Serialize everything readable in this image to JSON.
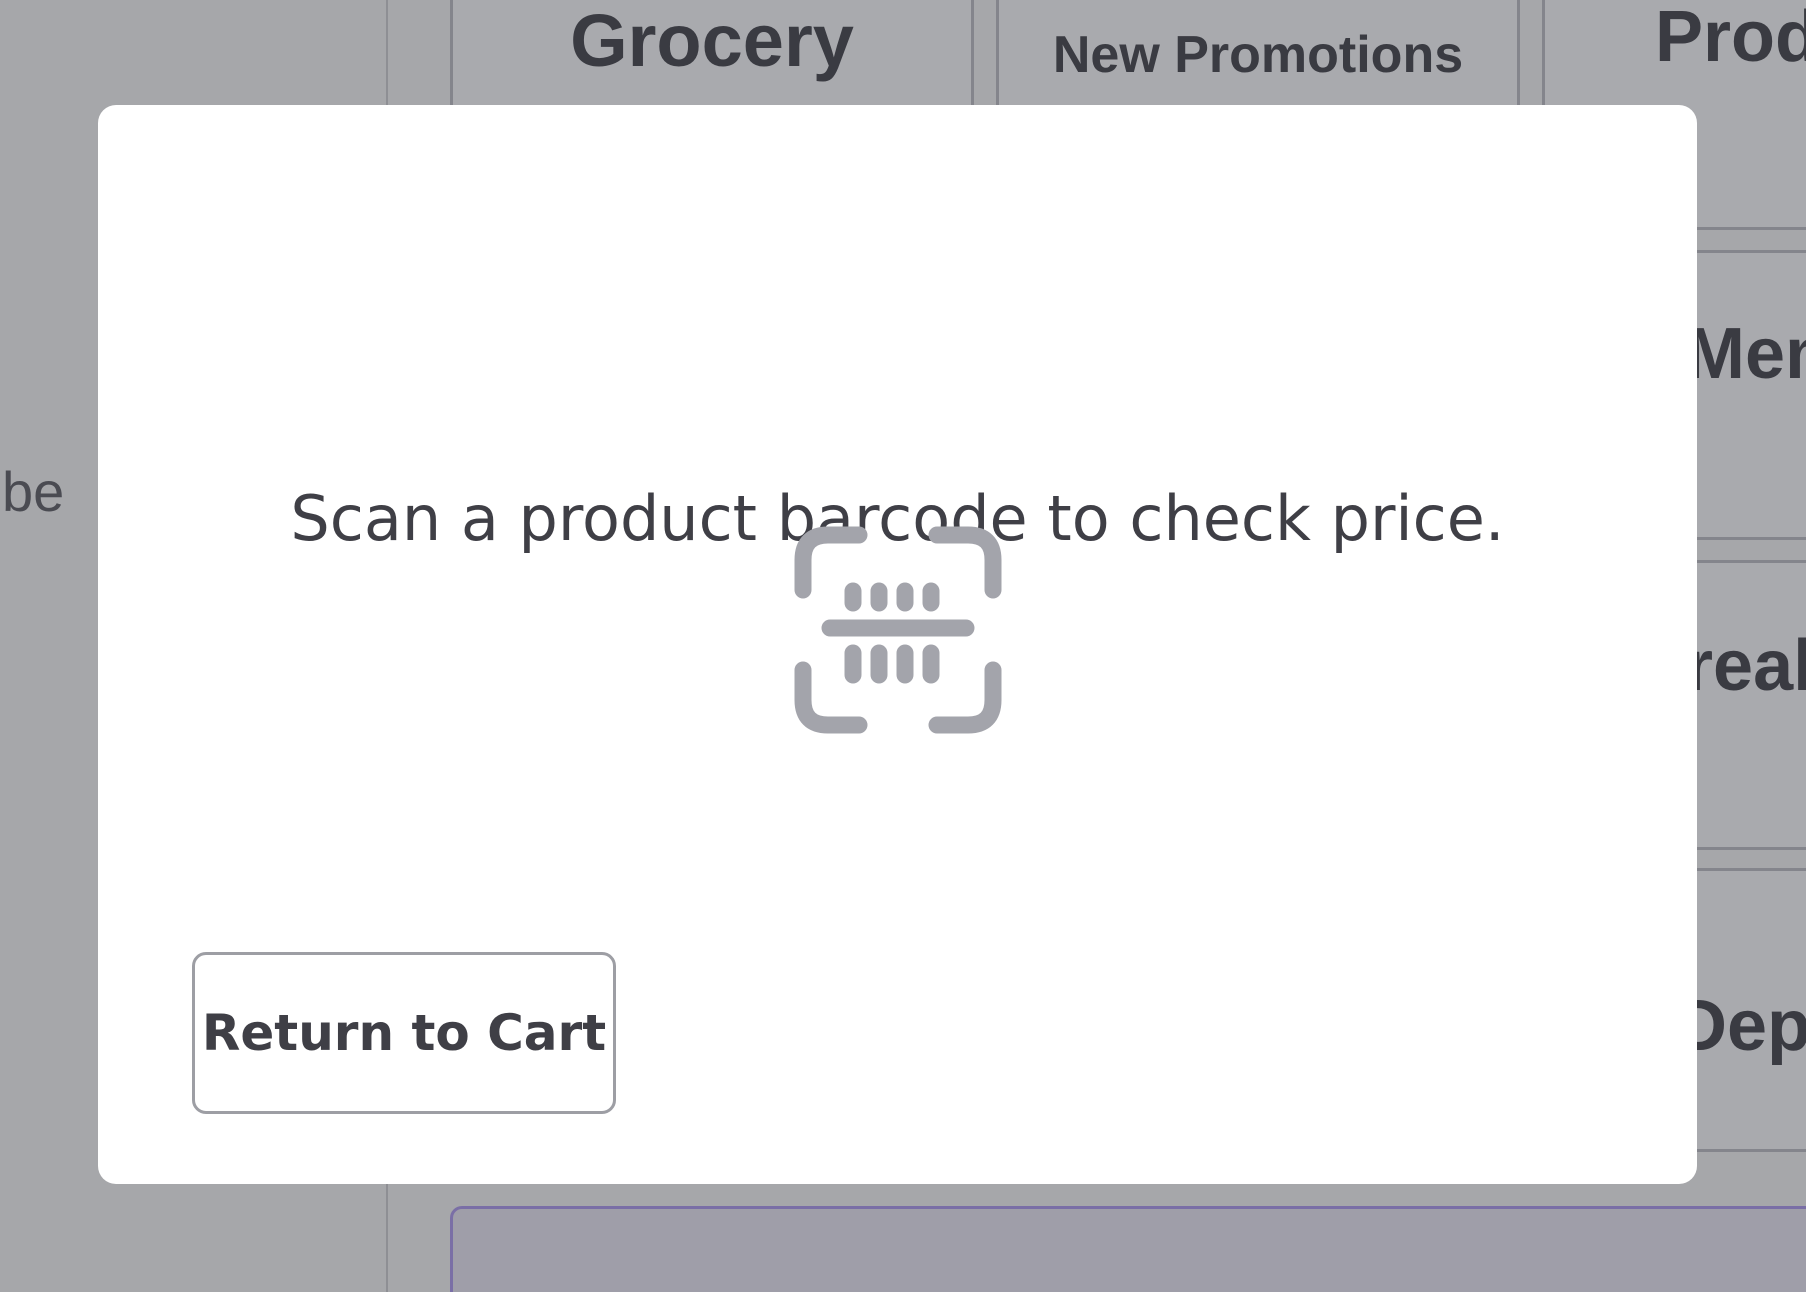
{
  "background": {
    "left_text": "be",
    "tiles": {
      "grocery": "Grocery",
      "promotions": "New Promotions",
      "product": "Prod",
      "member": "Mem",
      "break": "reak",
      "department": "Dep"
    }
  },
  "modal": {
    "message": "Scan a product barcode to check price.",
    "icon": "barcode-scan-icon",
    "return_button_label": "Return to Cart"
  },
  "colors": {
    "overlay": "#a6a7aa",
    "modal_bg": "#ffffff",
    "text": "#3f3f46",
    "icon": "#a3a4ab",
    "button_border": "#9d9ea4",
    "bottom_bar_border": "#7a6fa6"
  }
}
